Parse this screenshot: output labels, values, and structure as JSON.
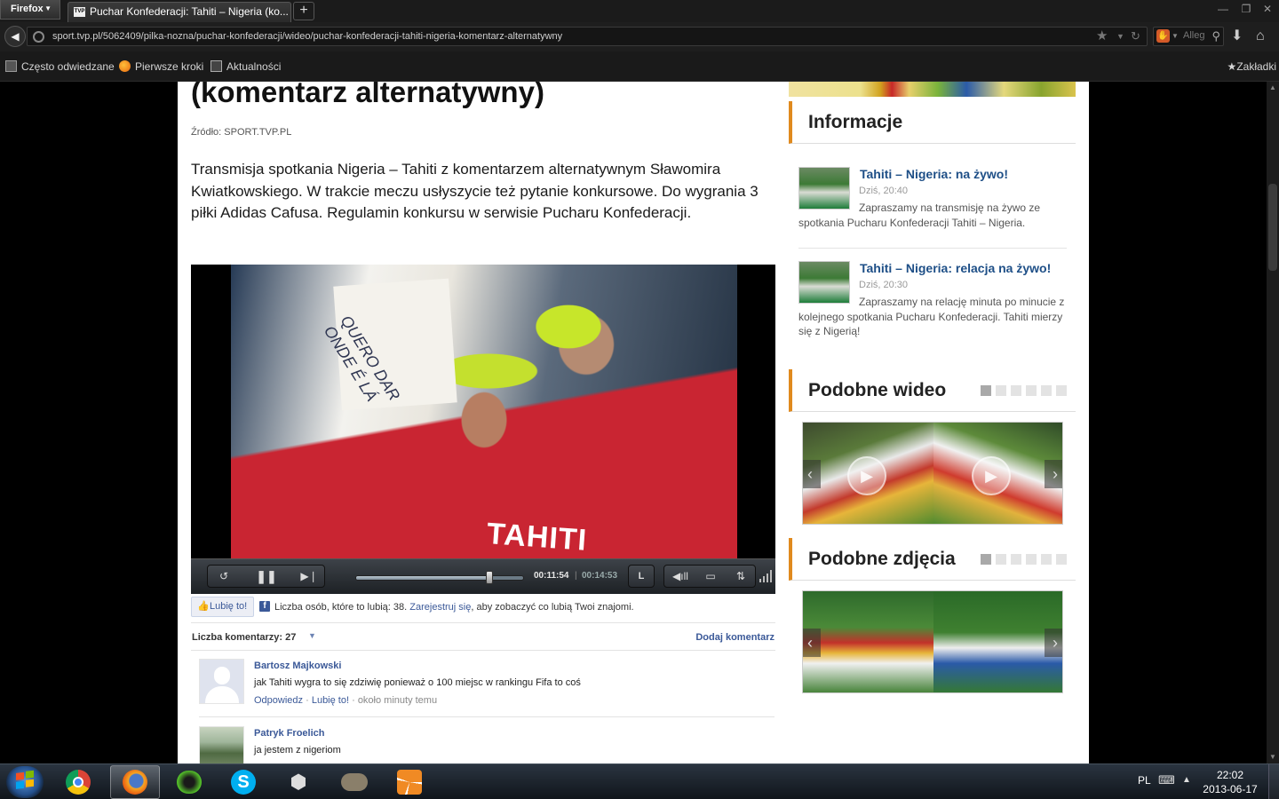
{
  "browser": {
    "menu_button": "Firefox",
    "tab_title": "Puchar Konfederacji: Tahiti – Nigeria (ko...",
    "tab_favicon": "TVP",
    "url": "sport.tvp.pl/5062409/pilka-nozna/puchar-konfederacji/wideo/puchar-konfederacji-tahiti-nigeria-komentarz-alternatywny",
    "search_placeholder": "Alleg",
    "bookmarks": [
      {
        "label": "Często odwiedzane",
        "icon": "page-icon"
      },
      {
        "label": "Pierwsze kroki",
        "icon": "firefox-icon"
      },
      {
        "label": "Aktualności",
        "icon": "rss-icon"
      }
    ],
    "bookmarks_menu": "Zakładki"
  },
  "article": {
    "title": "(komentarz alternatywny)",
    "source": "Źródło: SPORT.TVP.PL",
    "lead": "Transmisja spotkania Nigeria – Tahiti z komentarzem alternatywnym Sławomira Kwiatkowskiego. W trakcie meczu usłyszycie też pytanie konkursowe. Do wygrania 3 piłki Adidas Cafusa. Regulamin konkursu w serwisie Pucharu Konfederacji."
  },
  "video": {
    "shirt_text": "TAHITI",
    "sign_text": "QUERO DAR ONDE É LÁ",
    "time_current": "00:11:54",
    "time_separator": "|",
    "time_total": "00:14:53",
    "quality_label": "L",
    "progress": 0.8
  },
  "facebook": {
    "like_button": "Lubię to!",
    "like_text_before": "Liczba osób, które to lubią: 38.",
    "register_link": "Zarejestruj się",
    "like_text_after": ", aby zobaczyć co lubią Twoi znajomi."
  },
  "comments": {
    "count_label": "Liczba komentarzy: 27",
    "add_label": "Dodaj komentarz",
    "items": [
      {
        "author": "Bartosz Majkowski",
        "text": "jak Tahiti wygra to się zdziwię ponieważ o 100 miejsc w rankingu Fifa to coś",
        "reply": "Odpowiedz",
        "like": "Lubię to!",
        "time": "około minuty temu"
      },
      {
        "author": "Patryk Froelich",
        "text": "ja jestem z nigeriom"
      }
    ]
  },
  "sidebar": {
    "info_heading": "Informacje",
    "news": [
      {
        "title": "Tahiti – Nigeria: na żywo!",
        "date": "Dziś, 20:40",
        "desc": "Zapraszamy na transmisję na żywo ze spotkania Pucharu Konfederacji Tahiti – Nigeria."
      },
      {
        "title": "Tahiti – Nigeria: relacja na żywo!",
        "date": "Dziś, 20:30",
        "desc": "Zapraszamy na relację minuta po minucie z kolejnego spotkania Pucharu Konfederacji. Tahiti mierzy się z Nigerią!"
      }
    ],
    "similar_video_heading": "Podobne wideo",
    "similar_photos_heading": "Podobne zdjęcia",
    "carousel_pages": 6
  },
  "taskbar": {
    "language": "PL",
    "time": "22:02",
    "date": "2013-06-17",
    "apps": [
      "chrome-icon",
      "firefox-icon",
      "winamp-icon",
      "skype-icon",
      "hexagon-app-icon",
      "gimp-icon",
      "xmind-icon"
    ]
  },
  "colors": {
    "accent_orange": "#e08a1e",
    "link_blue": "#1e4f87",
    "facebook_blue": "#3b5998"
  }
}
